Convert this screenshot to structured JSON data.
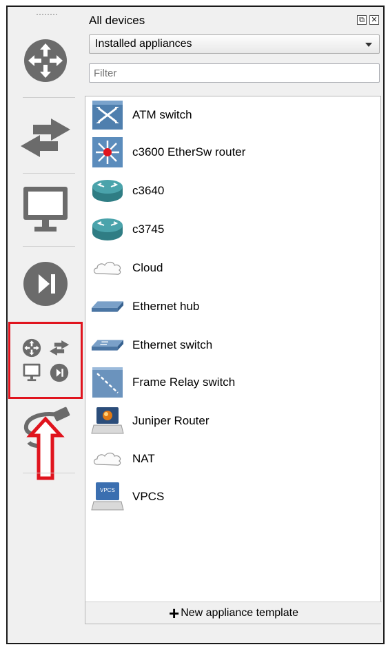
{
  "panel": {
    "title": "All devices",
    "restore_glyph": "⧉",
    "close_glyph": "✕",
    "dropdown": {
      "selected": "Installed appliances"
    },
    "filter": {
      "placeholder": "Filter",
      "value": ""
    },
    "footer": {
      "plus": "+",
      "label": "New appliance template"
    }
  },
  "toolbar": {
    "items": [
      {
        "icon": "router-category-icon"
      },
      {
        "icon": "switch-category-icon"
      },
      {
        "icon": "end-device-category-icon"
      },
      {
        "icon": "security-device-category-icon"
      },
      {
        "icon": "all-devices-category-icon",
        "highlighted": true
      },
      {
        "icon": "add-link-icon"
      }
    ],
    "highlight_color": "#e0141e"
  },
  "devices": [
    {
      "label": "ATM switch",
      "icon": "atm-switch-icon"
    },
    {
      "label": "c3600 EtherSw router",
      "icon": "etherswitch-router-icon"
    },
    {
      "label": "c3640",
      "icon": "router-icon"
    },
    {
      "label": "c3745",
      "icon": "router-icon"
    },
    {
      "label": "Cloud",
      "icon": "cloud-icon"
    },
    {
      "label": "Ethernet hub",
      "icon": "ethernet-hub-icon"
    },
    {
      "label": "Ethernet switch",
      "icon": "ethernet-switch-icon"
    },
    {
      "label": "Frame Relay switch",
      "icon": "frame-relay-switch-icon"
    },
    {
      "label": "Juniper Router",
      "icon": "juniper-router-icon"
    },
    {
      "label": "NAT",
      "icon": "nat-cloud-icon"
    },
    {
      "label": "VPCS",
      "icon": "vpcs-icon",
      "badge": "VPCS"
    }
  ],
  "colors": {
    "icon_gray": "#6b6b6b",
    "router_teal": "#3a8f96",
    "arrow_red": "#e0141e"
  }
}
